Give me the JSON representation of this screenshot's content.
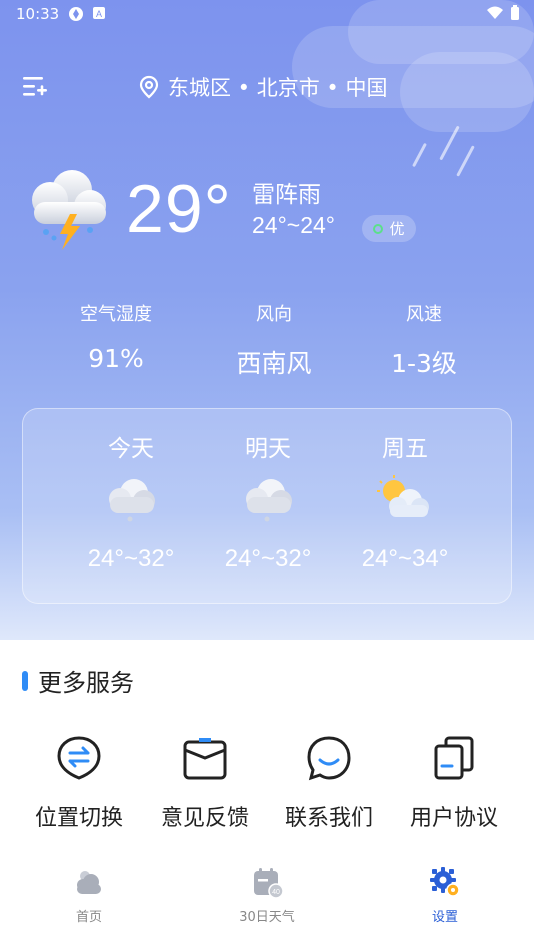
{
  "status_bar": {
    "time": "10:33"
  },
  "header": {
    "location": "东城区 • 北京市 • 中国",
    "icons": [
      "menu-add-icon",
      "location-pin-icon"
    ]
  },
  "current": {
    "temperature": "29°",
    "condition": "雷阵雨",
    "range": "24°~24°",
    "aqi": "优",
    "icon": "thunderstorm-icon"
  },
  "stats": [
    {
      "label": "空气湿度",
      "value": "91%"
    },
    {
      "label": "风向",
      "value": "西南风"
    },
    {
      "label": "风速",
      "value": "1-3级"
    }
  ],
  "forecast": [
    {
      "day": "今天",
      "range": "24°~32°",
      "icon": "rain-cloud-icon"
    },
    {
      "day": "明天",
      "range": "24°~32°",
      "icon": "rain-cloud-icon"
    },
    {
      "day": "周五",
      "range": "24°~34°",
      "icon": "partly-cloudy-icon"
    }
  ],
  "services": {
    "title": "更多服务",
    "items": [
      {
        "label": "位置切换",
        "icon": "switch-location-icon"
      },
      {
        "label": "意见反馈",
        "icon": "feedback-icon"
      },
      {
        "label": "联系我们",
        "icon": "chat-icon"
      },
      {
        "label": "用户协议",
        "icon": "agreement-icon"
      }
    ]
  },
  "tabs": [
    {
      "label": "首页",
      "icon": "cloud-sun-icon",
      "active": false
    },
    {
      "label": "30日天气",
      "icon": "calendar-icon",
      "badge": "40",
      "active": false
    },
    {
      "label": "设置",
      "icon": "gear-icon",
      "active": true
    }
  ],
  "colors": {
    "accent": "#2f8cf6",
    "active_tab": "#2b5fd6",
    "sky_top": "#7d93ee"
  }
}
